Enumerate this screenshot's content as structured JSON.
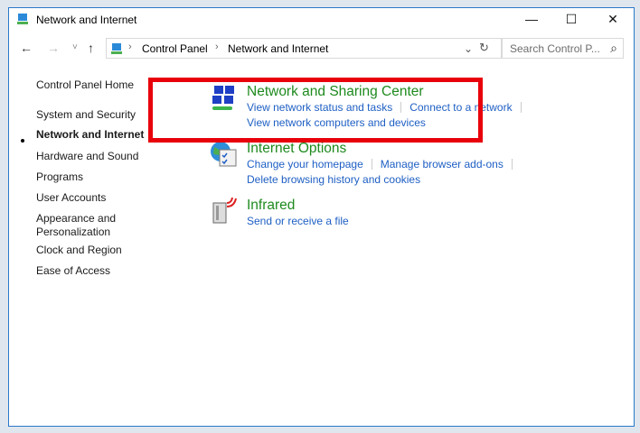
{
  "window": {
    "title": "Network and Internet",
    "minimize": "—",
    "maximize": "☐",
    "close": "✕"
  },
  "nav": {
    "back": "←",
    "forward": "→",
    "recent": "˅",
    "up": "↑",
    "crumbs": [
      "Control Panel",
      "Network and Internet"
    ],
    "dropdown": "⌄",
    "refresh": "↻",
    "search_placeholder": "Search Control P...",
    "search_icon": "⌕"
  },
  "sidebar": {
    "items": [
      {
        "label": "Control Panel Home"
      },
      {
        "label": "System and Security"
      },
      {
        "label": "Network and Internet",
        "current": true
      },
      {
        "label": "Hardware and Sound"
      },
      {
        "label": "Programs"
      },
      {
        "label": "User Accounts"
      },
      {
        "label": "Appearance and Personalization"
      },
      {
        "label": "Clock and Region"
      },
      {
        "label": "Ease of Access"
      }
    ]
  },
  "categories": [
    {
      "title": "Network and Sharing Center",
      "icon": "network-sharing-icon",
      "links": [
        "View network status and tasks",
        "Connect to a network",
        "View network computers and devices"
      ]
    },
    {
      "title": "Internet Options",
      "icon": "internet-options-icon",
      "links": [
        "Change your homepage",
        "Manage browser add-ons",
        "Delete browsing history and cookies"
      ]
    },
    {
      "title": "Infrared",
      "icon": "infrared-icon",
      "links": [
        "Send or receive a file"
      ]
    }
  ],
  "highlight_color": "#e8000b"
}
